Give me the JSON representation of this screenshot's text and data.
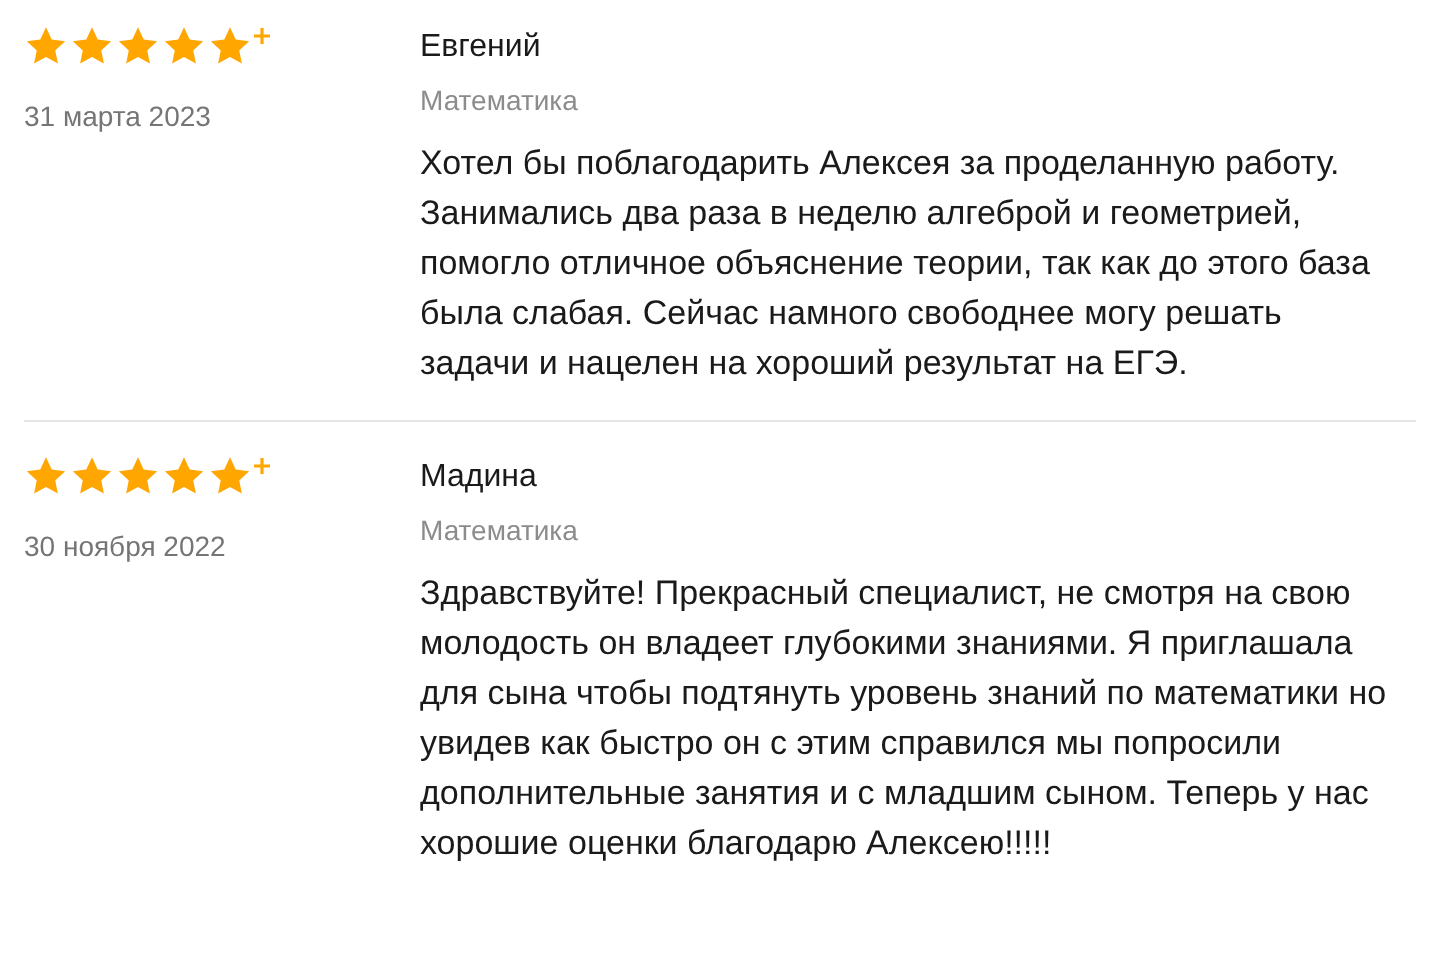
{
  "reviews": [
    {
      "stars": 5,
      "date": "31 марта 2023",
      "author": "Евгений",
      "subject": "Математика",
      "text": "Хотел бы поблагодарить Алексея за проделанную работу. Занимались два раза в неделю алгеброй и геометрией, помогло отличное объяснение теории, так как до этого база была слабая. Сейчас намного свободнее могу решать задачи и нацелен на хороший результат на ЕГЭ."
    },
    {
      "stars": 5,
      "date": "30 ноября 2022",
      "author": "Мадина",
      "subject": "Математика",
      "text": "Здравствуйте! Прекрасный специалист, не смотря на свою молодость он владеет глубокими знаниями. Я приглашала для сына чтобы подтянуть уровень знаний по математики но увидев как быстро он с этим справился мы попросили дополнительные занятия и с младшим сыном. Теперь у нас хорошие оценки благодарю Алексею!!!!!"
    }
  ]
}
